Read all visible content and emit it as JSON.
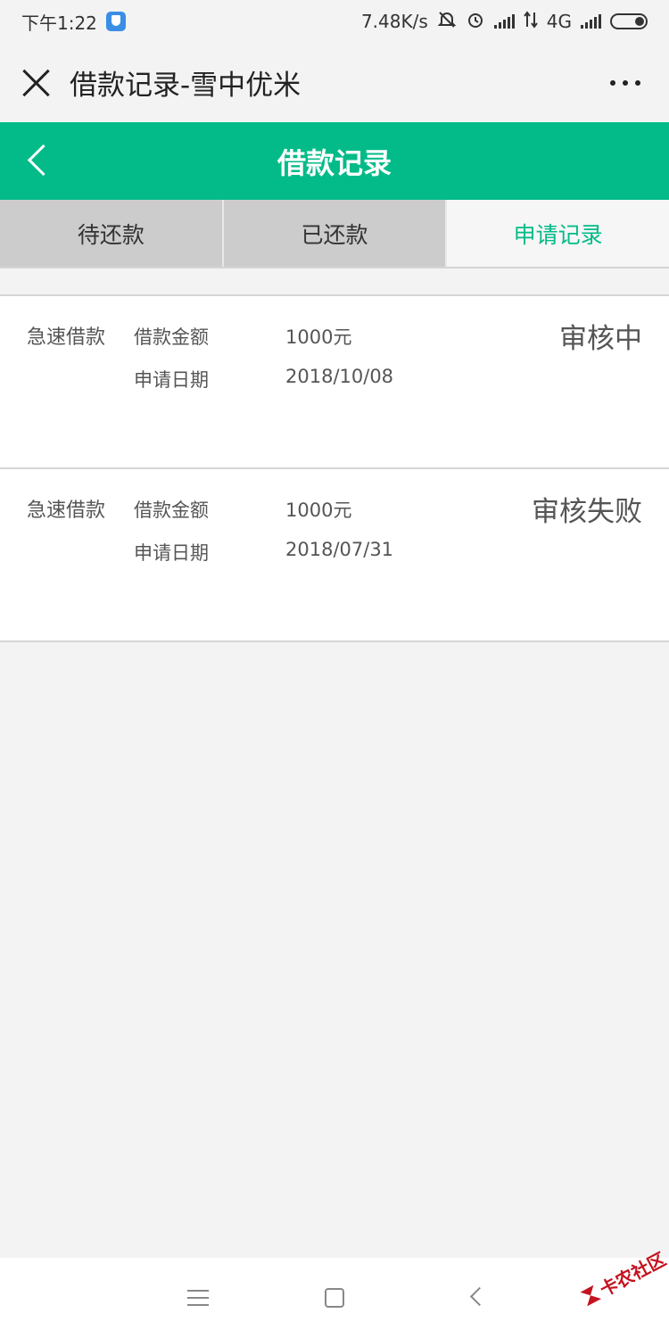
{
  "status_bar": {
    "time": "下午1:22",
    "speed": "7.48K/s",
    "network": "4G"
  },
  "title_bar": {
    "title": "借款记录-雪中优米"
  },
  "header": {
    "title": "借款记录"
  },
  "tabs": [
    {
      "label": "待还款",
      "active": false
    },
    {
      "label": "已还款",
      "active": false
    },
    {
      "label": "申请记录",
      "active": true
    }
  ],
  "records": [
    {
      "type": "急速借款",
      "amount_label": "借款金额",
      "amount": "1000元",
      "date_label": "申请日期",
      "date": "2018/10/08",
      "status": "审核中"
    },
    {
      "type": "急速借款",
      "amount_label": "借款金额",
      "amount": "1000元",
      "date_label": "申请日期",
      "date": "2018/07/31",
      "status": "审核失败"
    }
  ],
  "watermark": {
    "text": "卡农社区"
  },
  "colors": {
    "accent": "#03bb88",
    "tab_inactive_bg": "#cccccc",
    "page_bg": "#f3f3f3"
  }
}
